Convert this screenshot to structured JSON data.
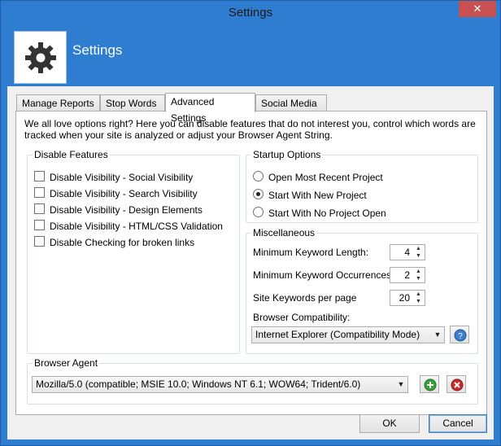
{
  "window": {
    "title": "Settings",
    "close_glyph": "✕"
  },
  "header": {
    "title": "Settings",
    "icon": "gear-icon"
  },
  "tabs": [
    {
      "label": "Manage Reports"
    },
    {
      "label": "Stop Words"
    },
    {
      "label": "Advanced Settings",
      "active": true
    },
    {
      "label": "Social Media"
    }
  ],
  "intro": "We all love options right? Here you can disable features that do not interest you, control which words are tracked when your site is analyzed or adjust your Browser Agent String.",
  "disable_features": {
    "legend": "Disable Features",
    "items": [
      {
        "label": "Disable Visibility - Social Visibility",
        "checked": false
      },
      {
        "label": "Disable Visibility - Search Visibility",
        "checked": false
      },
      {
        "label": "Disable Visibility - Design Elements",
        "checked": false
      },
      {
        "label": "Disable Visibility - HTML/CSS Validation",
        "checked": false
      },
      {
        "label": "Disable Checking for broken links",
        "checked": false
      }
    ]
  },
  "startup": {
    "legend": "Startup Options",
    "options": [
      {
        "label": "Open Most Recent Project",
        "selected": false
      },
      {
        "label": "Start With New Project",
        "selected": true
      },
      {
        "label": "Start With No Project Open",
        "selected": false
      }
    ]
  },
  "misc": {
    "legend": "Miscellaneous",
    "min_keyword_length": {
      "label": "Minimum Keyword Length:",
      "value": "4"
    },
    "min_keyword_occurrences": {
      "label": "Minimum Keyword Occurrences:",
      "value": "2"
    },
    "site_keywords_per_page": {
      "label": "Site Keywords per page",
      "value": "20"
    },
    "browser_compat": {
      "label": "Browser Compatibility:",
      "value": "Internet Explorer (Compatibility Mode)"
    }
  },
  "browser_agent": {
    "legend": "Browser Agent",
    "value": "Mozilla/5.0 (compatible; MSIE 10.0; Windows NT 6.1; WOW64; Trident/6.0)"
  },
  "buttons": {
    "ok": "OK",
    "cancel": "Cancel"
  },
  "colors": {
    "titlebar": "#2e7dd1",
    "close": "#c75050",
    "add": "#3aa03a",
    "remove": "#cc2a2a",
    "help": "#3c7fd0"
  }
}
